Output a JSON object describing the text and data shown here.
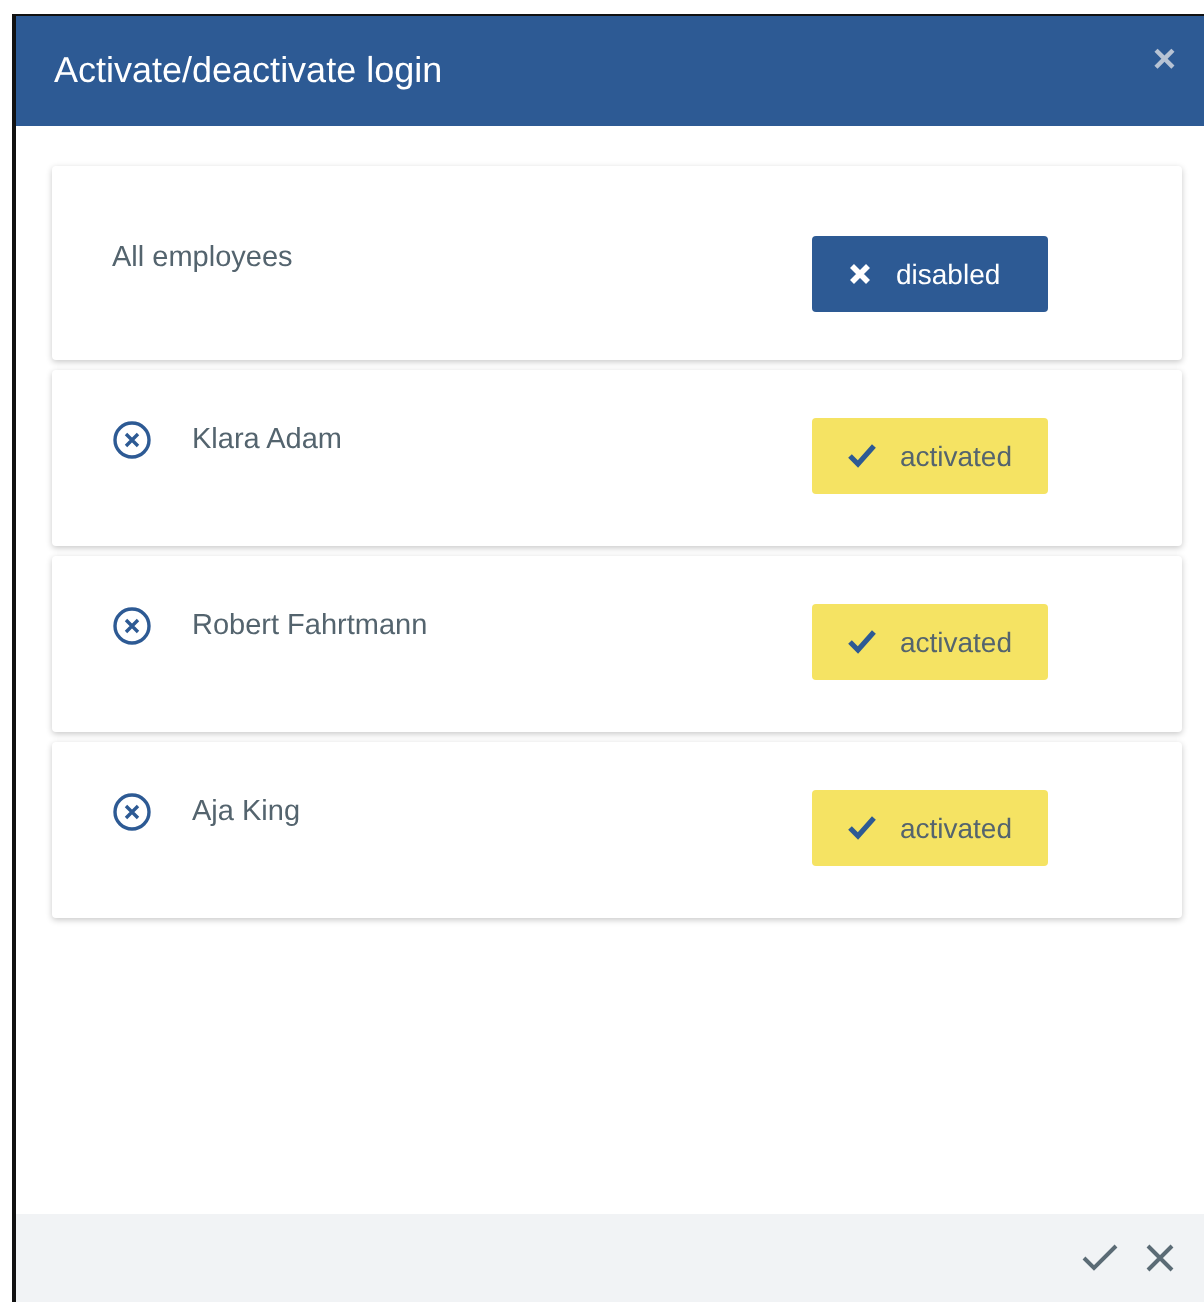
{
  "dialog": {
    "title": "Activate/deactivate login",
    "close": "×"
  },
  "rows": [
    {
      "kind": "all",
      "name": "All employees",
      "active": false,
      "status": "disabled"
    },
    {
      "kind": "employee",
      "name": "Klara Adam",
      "active": true,
      "status": "activated"
    },
    {
      "kind": "employee",
      "name": "Robert Fahrtmann",
      "active": true,
      "status": "activated"
    },
    {
      "kind": "employee",
      "name": "Aja King",
      "active": true,
      "status": "activated"
    }
  ]
}
